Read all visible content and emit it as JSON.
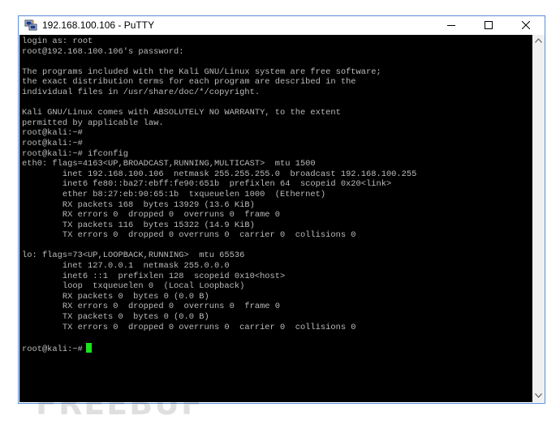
{
  "window": {
    "title": "192.168.100.106 - PuTTY",
    "controls": {
      "minimize": "minimize",
      "maximize": "maximize",
      "close": "close"
    }
  },
  "terminal": {
    "foreground": "#bbbbbb",
    "background": "#000000",
    "cursor_color": "#1de31d",
    "lines": [
      "login as: root",
      "root@192.168.100.106's password:",
      "",
      "The programs included with the Kali GNU/Linux system are free software;",
      "the exact distribution terms for each program are described in the",
      "individual files in /usr/share/doc/*/copyright.",
      "",
      "Kali GNU/Linux comes with ABSOLUTELY NO WARRANTY, to the extent",
      "permitted by applicable law.",
      "root@kali:~#",
      "root@kali:~#",
      "root@kali:~# ifconfig",
      "eth0: flags=4163<UP,BROADCAST,RUNNING,MULTICAST>  mtu 1500",
      "        inet 192.168.100.106  netmask 255.255.255.0  broadcast 192.168.100.255",
      "        inet6 fe80::ba27:ebff:fe90:651b  prefixlen 64  scopeid 0x20<link>",
      "        ether b8:27:eb:90:65:1b  txqueuelen 1000  (Ethernet)",
      "        RX packets 168  bytes 13929 (13.6 KiB)",
      "        RX errors 0  dropped 0  overruns 0  frame 0",
      "        TX packets 116  bytes 15322 (14.9 KiB)",
      "        TX errors 0  dropped 0 overruns 0  carrier 0  collisions 0",
      "",
      "lo: flags=73<UP,LOOPBACK,RUNNING>  mtu 65536",
      "        inet 127.0.0.1  netmask 255.0.0.0",
      "        inet6 ::1  prefixlen 128  scopeid 0x10<host>",
      "        loop  txqueuelen 0  (Local Loopback)",
      "        RX packets 0  bytes 0 (0.0 B)",
      "        RX errors 0  dropped 0  overruns 0  frame 0",
      "        TX packets 0  bytes 0 (0.0 B)",
      "        TX errors 0  dropped 0 overruns 0  carrier 0  collisions 0",
      "",
      "root@kali:~#"
    ]
  },
  "watermark": {
    "text": "FREEBUF"
  }
}
